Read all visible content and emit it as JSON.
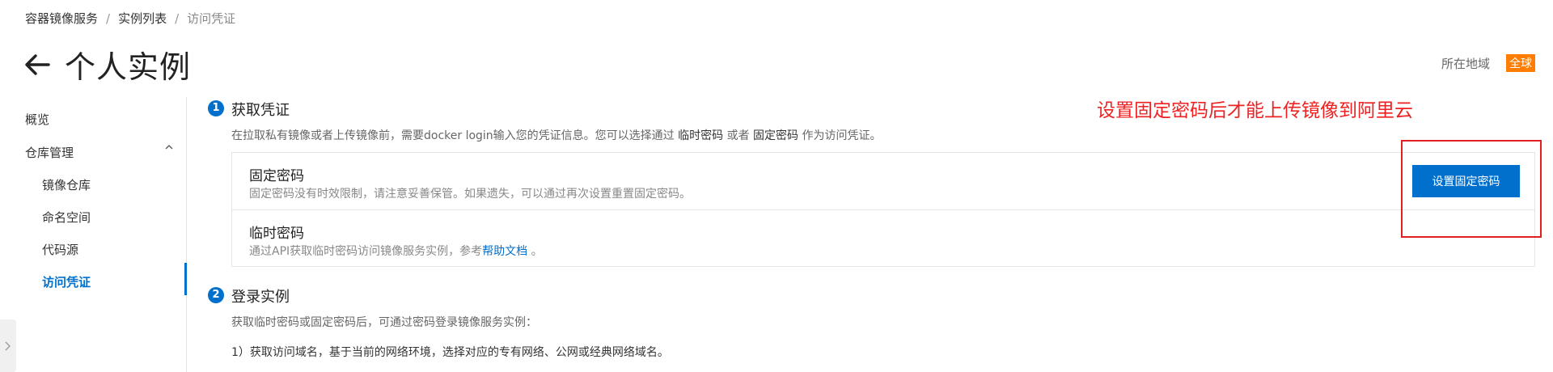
{
  "breadcrumb": {
    "items": [
      "容器镜像服务",
      "实例列表",
      "访问凭证"
    ],
    "separator": "/"
  },
  "header": {
    "title": "个人实例",
    "region_label": "所在地域",
    "region_value": "全球"
  },
  "sidebar": {
    "items": [
      {
        "label": "概览"
      },
      {
        "label": "仓库管理"
      },
      {
        "label": "镜像仓库"
      },
      {
        "label": "命名空间"
      },
      {
        "label": "代码源"
      },
      {
        "label": "访问凭证"
      }
    ]
  },
  "step1": {
    "number": "1",
    "title": "获取凭证",
    "desc_prefix": "在拉取私有镜像或者上传镜像前，需要docker login输入您的凭证信息。您可以选择通过",
    "desc_opt1": "临时密码",
    "desc_mid": "或者",
    "desc_opt2": "固定密码",
    "desc_suffix": "作为访问凭证。"
  },
  "fixed_password": {
    "title": "固定密码",
    "desc": "固定密码没有时效限制，请注意妥善保管。如果遗失，可以通过再次设置重置固定密码。",
    "button": "设置固定密码"
  },
  "temp_password": {
    "title": "临时密码",
    "desc_prefix": "通过API获取临时密码访问镜像服务实例，参考",
    "link": "帮助文档",
    "desc_suffix": "。"
  },
  "step2": {
    "number": "2",
    "title": "登录实例",
    "desc": "获取临时密码或固定密码后，可通过密码登录镜像服务实例：",
    "item1": "1）获取访问域名，基于当前的网络环境，选择对应的专有网络、公网或经典网络域名。"
  },
  "annotation": {
    "text": "设置固定密码后才能上传镜像到阿里云",
    "color": "#ee2222"
  },
  "colors": {
    "accent": "#0070cc",
    "badge": "#ff7d00"
  }
}
